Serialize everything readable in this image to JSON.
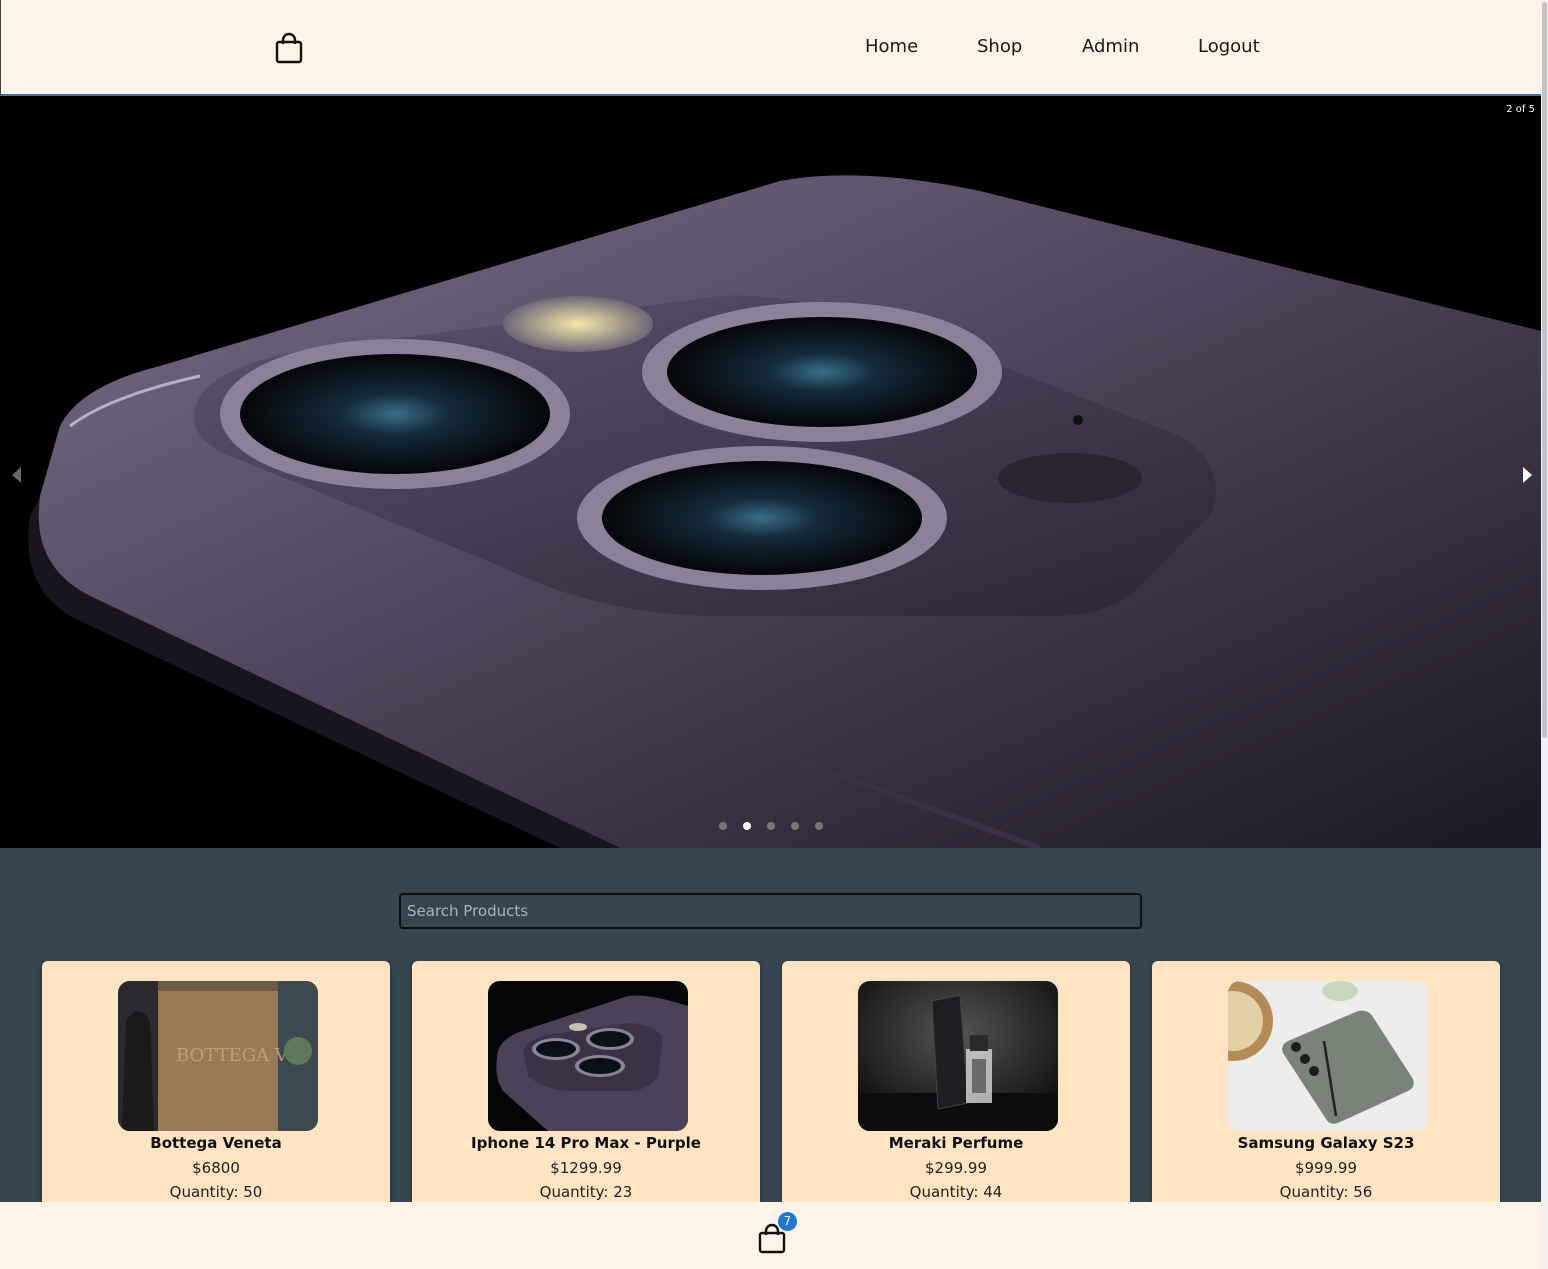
{
  "header": {
    "logo_icon": "shopping-bag-icon",
    "nav": [
      "Home",
      "Shop",
      "Admin",
      "Logout"
    ]
  },
  "carousel": {
    "counter": "2 of 5",
    "total_slides": 5,
    "active_slide": 2,
    "left_arrow_icon": "arrow-left-icon",
    "right_arrow_icon": "arrow-right-icon"
  },
  "search": {
    "placeholder": "Search Products",
    "value": ""
  },
  "products": [
    {
      "name": "Bottega Veneta",
      "price": "$6800",
      "quantity": "Quantity: 50"
    },
    {
      "name": "Iphone 14 Pro Max - Purple",
      "price": "$1299.99",
      "quantity": "Quantity: 23"
    },
    {
      "name": "Meraki Perfume",
      "price": "$299.99",
      "quantity": "Quantity: 44"
    },
    {
      "name": "Samsung Galaxy S23",
      "price": "$999.99",
      "quantity": "Quantity: 56"
    }
  ],
  "cart": {
    "icon": "shopping-bag-icon",
    "count": "7"
  },
  "colors": {
    "header_bg": "#fdf3e6",
    "section_bg": "#36454f",
    "card_bg": "#ffe4c4",
    "badge": "#1f77d4"
  }
}
